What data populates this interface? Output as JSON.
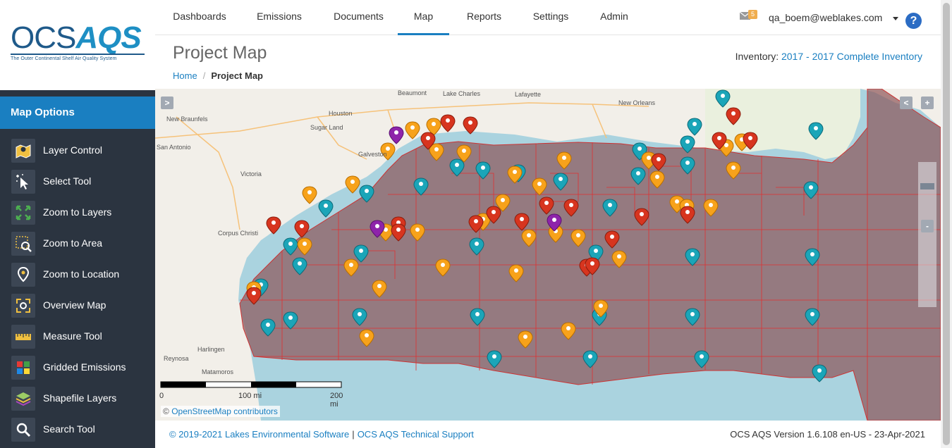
{
  "logo": {
    "part1": "OCS",
    "part2": "AQS",
    "tagline": "The Outer Continental Shelf Air Quality System"
  },
  "sidebar": {
    "header": "Map Options",
    "items": [
      {
        "label": "Layer Control",
        "icon": "layer-control-icon"
      },
      {
        "label": "Select Tool",
        "icon": "select-tool-icon"
      },
      {
        "label": "Zoom to Layers",
        "icon": "zoom-layers-icon"
      },
      {
        "label": "Zoom to Area",
        "icon": "zoom-area-icon"
      },
      {
        "label": "Zoom to Location",
        "icon": "zoom-location-icon"
      },
      {
        "label": "Overview Map",
        "icon": "overview-map-icon"
      },
      {
        "label": "Measure Tool",
        "icon": "measure-tool-icon"
      },
      {
        "label": "Gridded Emissions",
        "icon": "gridded-emissions-icon"
      },
      {
        "label": "Shapefile Layers",
        "icon": "shapefile-layers-icon"
      },
      {
        "label": "Search Tool",
        "icon": "search-tool-icon"
      }
    ]
  },
  "nav": {
    "tabs": [
      "Dashboards",
      "Emissions",
      "Documents",
      "Map",
      "Reports",
      "Settings",
      "Admin"
    ],
    "active": "Map",
    "mail_count": "5",
    "user": "qa_boem@weblakes.com",
    "help": "?"
  },
  "page": {
    "title": "Project Map",
    "breadcrumb_home": "Home",
    "breadcrumb_current": "Project Map",
    "inventory_label": "Inventory:",
    "inventory_value": "2017 - 2017 Complete Inventory"
  },
  "map": {
    "places": [
      "Beaumont",
      "Lake Charles",
      "Lafayette",
      "New Orleans",
      "Houston",
      "Sugar Land",
      "New Braunfels",
      "San Antonio",
      "Galveston",
      "Victoria",
      "Corpus Christi",
      "Matamoros",
      "Harlingen",
      "Reynosa"
    ],
    "expand_button": ">",
    "collapse_button": "<",
    "zoom_in": "+",
    "zoom_out": "-",
    "scale": {
      "labels": [
        "0",
        "100 mi",
        "200 mi"
      ]
    },
    "attribution_symbol": "©",
    "attribution": "OpenStreetMap contributors",
    "colors": {
      "planning_area": "#8a4f53",
      "block_lines": "#e03030",
      "water": "#aad3df",
      "land": "#f2efe9"
    }
  },
  "footer": {
    "copyright": "© 2019-2021 Lakes Environmental Software",
    "support": "OCS AQS Technical Support",
    "version": "OCS AQS Version 1.6.108 en-US - 23-Apr-2021"
  }
}
